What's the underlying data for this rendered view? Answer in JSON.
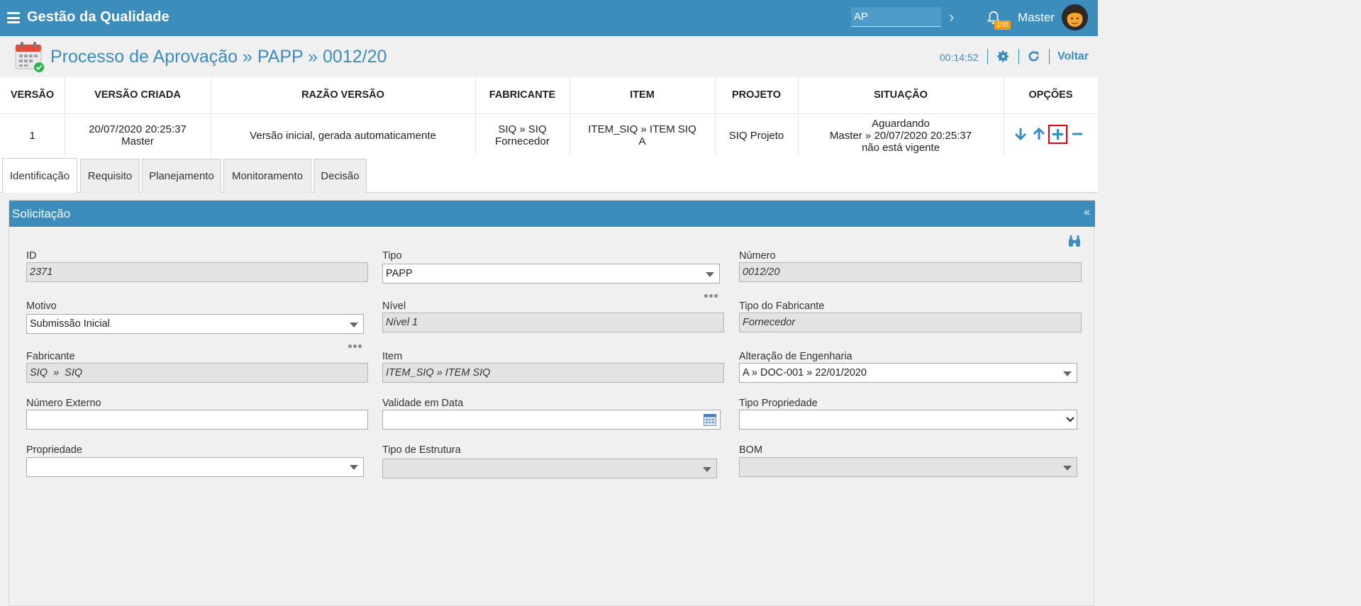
{
  "header": {
    "app_title": "Gestão da Qualidade",
    "search_value": "AP",
    "notifications_count": "100",
    "user_name": "Master"
  },
  "titlebar": {
    "title": "Processo de Aprovação » PAPP » 0012/20",
    "timer": "00:14:52",
    "back_label": "Voltar"
  },
  "versions": {
    "columns": [
      "VERSÃO",
      "VERSÃO CRIADA",
      "RAZÃO VERSÃO",
      "FABRICANTE",
      "ITEM",
      "PROJETO",
      "SITUAÇÃO",
      "OPÇÕES"
    ],
    "row": {
      "version": "1",
      "created_date": "20/07/2020 20:25:37",
      "created_by": "Master",
      "reason": "Versão inicial, gerada automaticamente",
      "manufacturer_1": "SIQ » SIQ",
      "manufacturer_2": "Fornecedor",
      "item_1": "ITEM_SIQ » ITEM SIQ",
      "item_2": "A",
      "project": "SIQ Projeto",
      "status_1": "Aguardando",
      "status_2": "Master » 20/07/2020 20:25:37",
      "status_3": "não está vigente"
    }
  },
  "tabs": [
    "Identificação",
    "Requisito",
    "Planejamento",
    "Monitoramento",
    "Decisão"
  ],
  "panel": {
    "title": "Solicitação",
    "collapse": "«",
    "fields": {
      "id": {
        "label": "ID",
        "value": "2371"
      },
      "tipo": {
        "label": "Tipo",
        "value": "PAPP"
      },
      "numero": {
        "label": "Número",
        "value": "0012/20"
      },
      "motivo": {
        "label": "Motivo",
        "value": "Submissão Inicial"
      },
      "nivel": {
        "label": "Nível",
        "value": "Nível 1"
      },
      "tipo_fabricante": {
        "label": "Tipo do Fabricante",
        "value": "Fornecedor"
      },
      "fabricante": {
        "label": "Fabricante",
        "value": "SIQ  »  SIQ"
      },
      "item": {
        "label": "Item",
        "value": "ITEM_SIQ » ITEM SIQ"
      },
      "alteracao": {
        "label": "Alteração de Engenharia",
        "value": "A » DOC-001 » 22/01/2020"
      },
      "numero_externo": {
        "label": "Número Externo",
        "value": ""
      },
      "validade": {
        "label": "Validade em Data",
        "value": ""
      },
      "tipo_propriedade": {
        "label": "Tipo Propriedade",
        "value": ""
      },
      "propriedade": {
        "label": "Propriedade",
        "value": ""
      },
      "tipo_estrutura": {
        "label": "Tipo de Estrutura",
        "value": ""
      },
      "bom": {
        "label": "BOM",
        "value": ""
      }
    }
  }
}
